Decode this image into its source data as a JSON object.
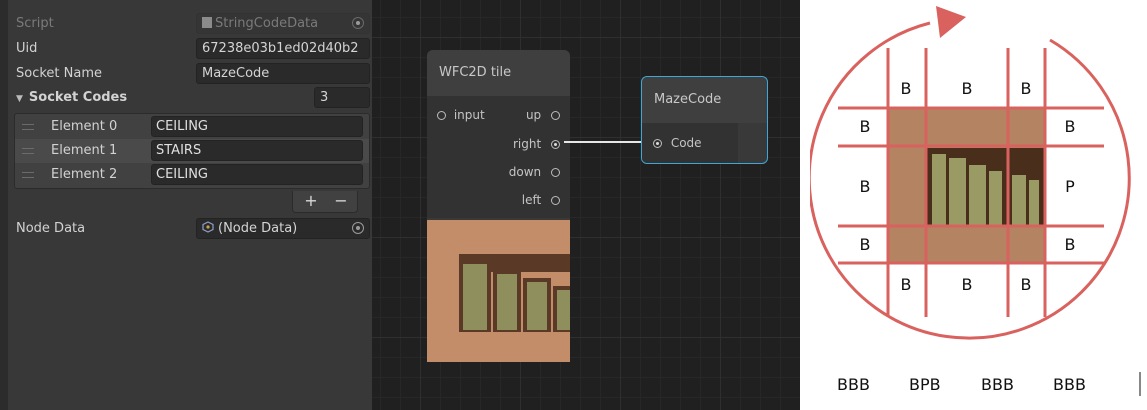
{
  "inspector": {
    "script": {
      "label": "Script",
      "value": "StringCodeData"
    },
    "uid": {
      "label": "Uid",
      "value": "67238e03b1ed02d40b2"
    },
    "socket_name": {
      "label": "Socket Name",
      "value": "MazeCode"
    },
    "socket_codes": {
      "label": "Socket Codes",
      "count": "3",
      "elements": [
        {
          "label": "Element 0",
          "value": "CEILING"
        },
        {
          "label": "Element 1",
          "value": "STAIRS"
        },
        {
          "label": "Element 2",
          "value": "CEILING"
        }
      ],
      "add_label": "+",
      "remove_label": "−"
    },
    "node_data": {
      "label": "Node Data",
      "value": "(Node Data)"
    }
  },
  "graph": {
    "tile_node": {
      "title": "WFC2D tile",
      "input_port": "input",
      "output_ports": [
        "up",
        "right",
        "down",
        "left"
      ]
    },
    "code_node": {
      "title": "MazeCode",
      "port": "Code"
    },
    "colors": {
      "selection": "#3fa7d6",
      "wire": "#e6e6e6",
      "tile_bg": "#c38d6a"
    }
  },
  "diagram": {
    "top_labels": [
      "B",
      "B",
      "B"
    ],
    "bottom_labels": [
      "B",
      "B",
      "B"
    ],
    "left_labels": [
      "B",
      "B",
      "B"
    ],
    "right_labels": [
      "B",
      "P",
      "B"
    ],
    "codes": [
      "BBB",
      "BPB",
      "BBB",
      "BBB"
    ],
    "colors": {
      "arrow": "#d9625e",
      "grid": "#d9625e",
      "tile": "#b38362",
      "stairs": "#9a9b64"
    }
  }
}
